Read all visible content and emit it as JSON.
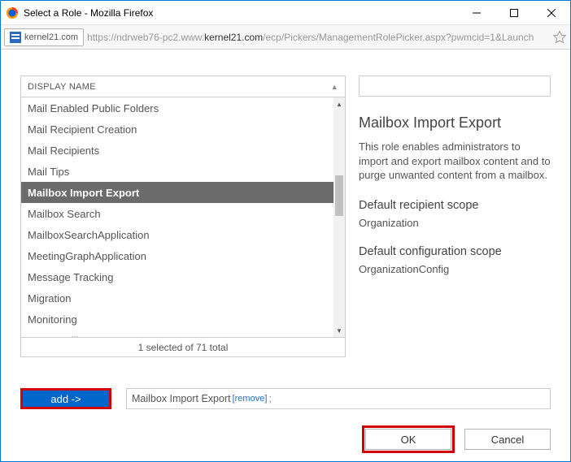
{
  "window": {
    "title": "Select a Role - Mozilla Firefox"
  },
  "addressbar": {
    "site": "kernel21.com",
    "url_prefix": "https://ndrweb76-pc2.www.",
    "url_host": "kernel21.com",
    "url_suffix": "/ecp/Pickers/ManagementRolePicker.aspx?pwmcid=1&Launch"
  },
  "list": {
    "header": "DISPLAY NAME",
    "items": [
      {
        "label": "Mail Enabled Public Folders",
        "selected": false
      },
      {
        "label": "Mail Recipient Creation",
        "selected": false
      },
      {
        "label": "Mail Recipients",
        "selected": false
      },
      {
        "label": "Mail Tips",
        "selected": false
      },
      {
        "label": "Mailbox Import Export",
        "selected": true
      },
      {
        "label": "Mailbox Search",
        "selected": false
      },
      {
        "label": "MailboxSearchApplication",
        "selected": false
      },
      {
        "label": "MeetingGraphApplication",
        "selected": false
      },
      {
        "label": "Message Tracking",
        "selected": false
      },
      {
        "label": "Migration",
        "selected": false
      },
      {
        "label": "Monitoring",
        "selected": false
      },
      {
        "label": "Move Mailboxes",
        "selected": false
      }
    ],
    "footer": "1 selected of 71 total"
  },
  "detail": {
    "title": "Mailbox Import Export",
    "description": "This role enables administrators to import and export mailbox content and to purge unwanted content from a mailbox.",
    "recipient_scope_label": "Default recipient scope",
    "recipient_scope_value": "Organization",
    "config_scope_label": "Default configuration scope",
    "config_scope_value": "OrganizationConfig"
  },
  "add": {
    "button": "add ->",
    "item": "Mailbox Import Export",
    "remove": "[remove]",
    "tail": ";"
  },
  "buttons": {
    "ok": "OK",
    "cancel": "Cancel"
  }
}
